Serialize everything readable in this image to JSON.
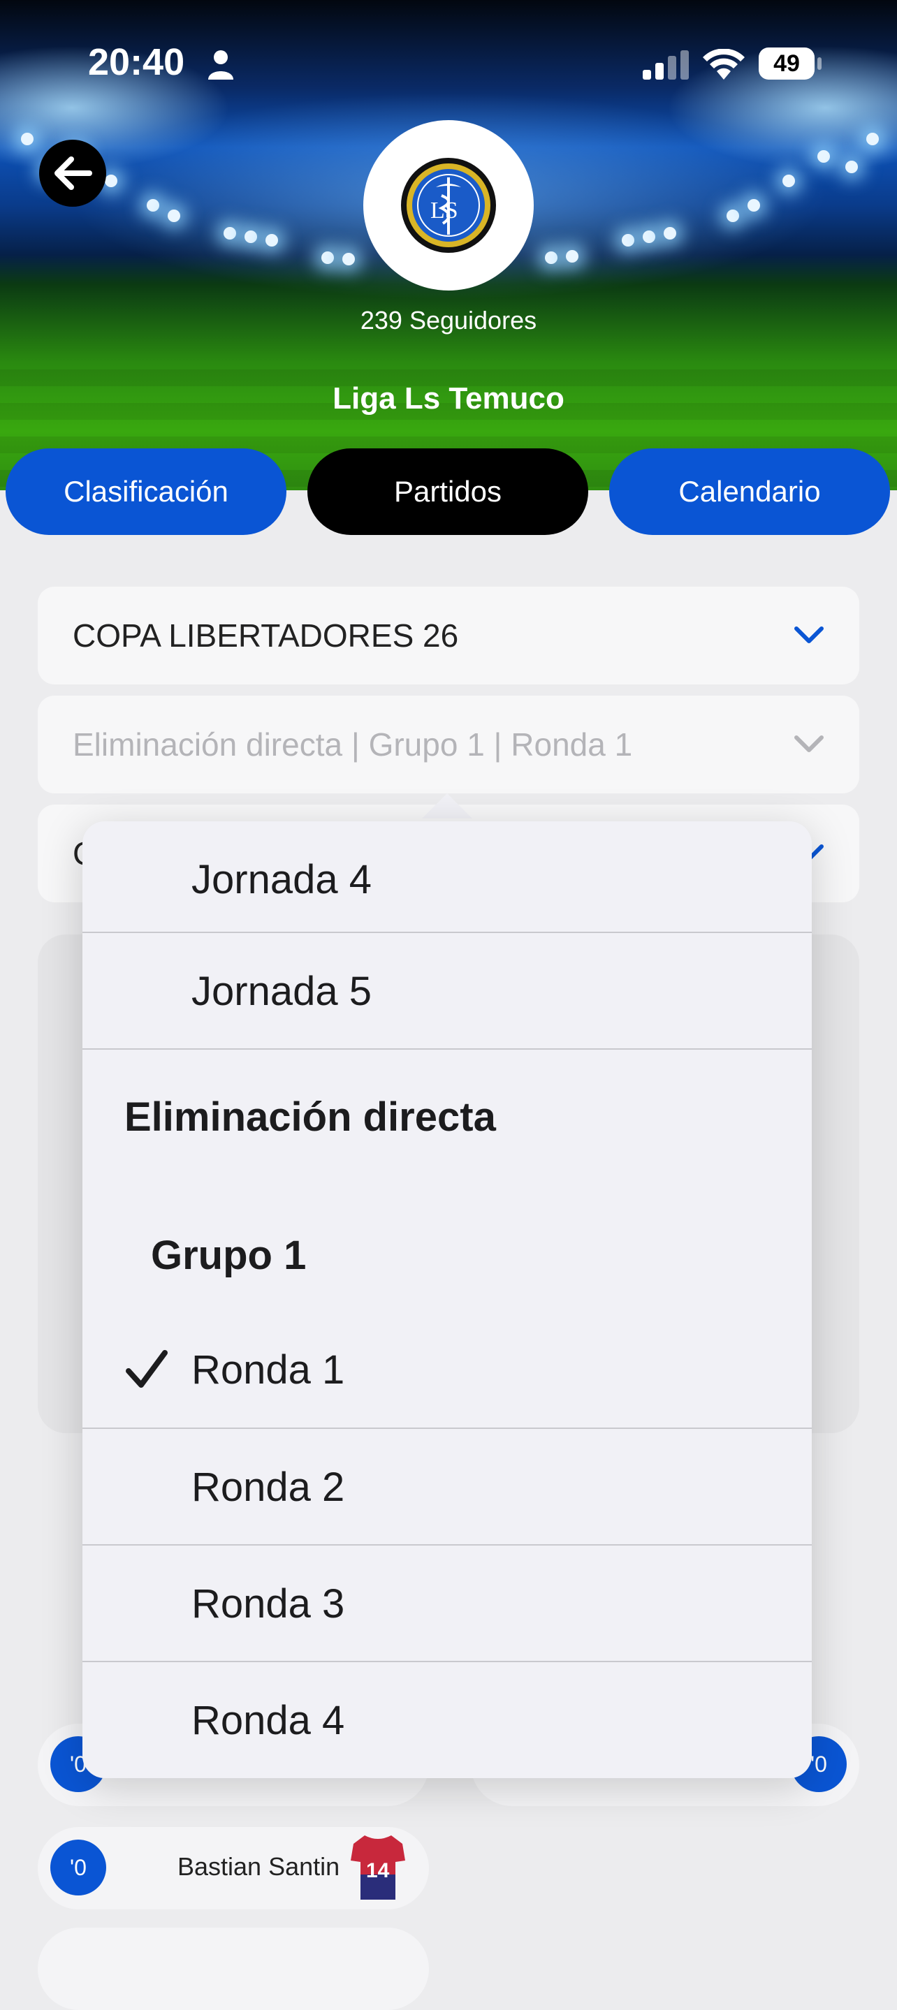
{
  "status_bar": {
    "time": "20:40",
    "battery": "49"
  },
  "header": {
    "followers": "239 Seguidores",
    "league_name": "Liga Ls Temuco",
    "logo_text": "LS"
  },
  "tabs": [
    {
      "label": "Clasificación"
    },
    {
      "label": "Partidos"
    },
    {
      "label": "Calendario"
    }
  ],
  "selects": {
    "competition": "COPA LIBERTADORES 26",
    "phase": "Eliminación directa | Grupo 1 | Ronda 1",
    "third_partial": "C"
  },
  "menu": {
    "items_top": [
      "Jornada 4",
      "Jornada 5"
    ],
    "section_heading": "Eliminación directa",
    "group_heading": "Grupo 1",
    "rounds": [
      "Ronda 1",
      "Ronda 2",
      "Ronda 3",
      "Ronda 4"
    ],
    "selected": "Ronda 1"
  },
  "lineup": {
    "badge_left": "'0",
    "badge_right": "'0",
    "player_name": "Bastian Santin",
    "player_badge": "'0",
    "shirt_number": "14"
  },
  "colors": {
    "accent_blue": "#0a55d4",
    "active_tab": "#000000"
  }
}
